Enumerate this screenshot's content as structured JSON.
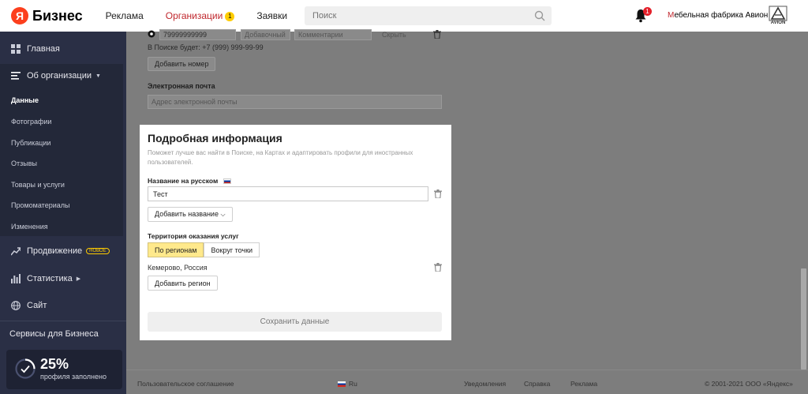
{
  "colors": {
    "sidebar_bg": "#2a2f45",
    "accent_yellow": "#ffe98c",
    "brand_red": "#fc3f1d",
    "overlay": "#7d7d7d"
  },
  "header": {
    "logo_letter": "Я",
    "logo_text": "Бизнес",
    "nav": [
      {
        "label": "Реклама"
      },
      {
        "label": "Организации",
        "badge": "1"
      },
      {
        "label": "Заявки"
      }
    ],
    "search_placeholder": "Поиск",
    "notifications_count": "1",
    "org_first_letter": "М",
    "org_rest": "ебельная фабрика Авион",
    "org_logo_text": "AVION"
  },
  "sidebar": {
    "main_item": "Главная",
    "org_item": "Об организации",
    "org_subitems": [
      "Данные",
      "Фотографии",
      "Публикации",
      "Отзывы",
      "Товары и услуги",
      "Промоматериалы",
      "Изменения"
    ],
    "promo_item": "Продвижение",
    "promo_badge": "НОВОЕ",
    "stats_item": "Статистика",
    "site_item": "Сайт",
    "services": "Сервисы для Бизнеса",
    "progress_value": "25%",
    "progress_fraction": 0.25,
    "progress_label": "профиля заполнено"
  },
  "contacts": {
    "phone_value": "79999999999",
    "extension_placeholder": "Добавочный",
    "comment_placeholder": "Комментарии",
    "hide_label": "Скрыть",
    "search_preview": "В Поиске будет: +7 (999) 999-99-99",
    "add_phone": "Добавить номер",
    "email_label": "Электронная почта",
    "email_placeholder": "Адрес электронной почты"
  },
  "details": {
    "title": "Подробная информация",
    "description": "Поможет лучше вас найти в Поиске, на Картах и адаптировать профили для иностранных пользователей.",
    "name_label": "Название на русском",
    "name_value": "Тест",
    "add_name": "Добавить название",
    "territory_label": "Территория оказания услуг",
    "seg_regions": "По регионам",
    "seg_point": "Вокруг точки",
    "region_value": "Кемерово, Россия",
    "add_region": "Добавить регион",
    "save": "Сохранить данные"
  },
  "footer": {
    "agreement": "Пользовательское соглашение",
    "lang": "Ru",
    "notifications": "Уведомления",
    "help": "Справка",
    "ads": "Реклама",
    "copyright": "© 2001-2021 ООО «Яндекс»"
  }
}
